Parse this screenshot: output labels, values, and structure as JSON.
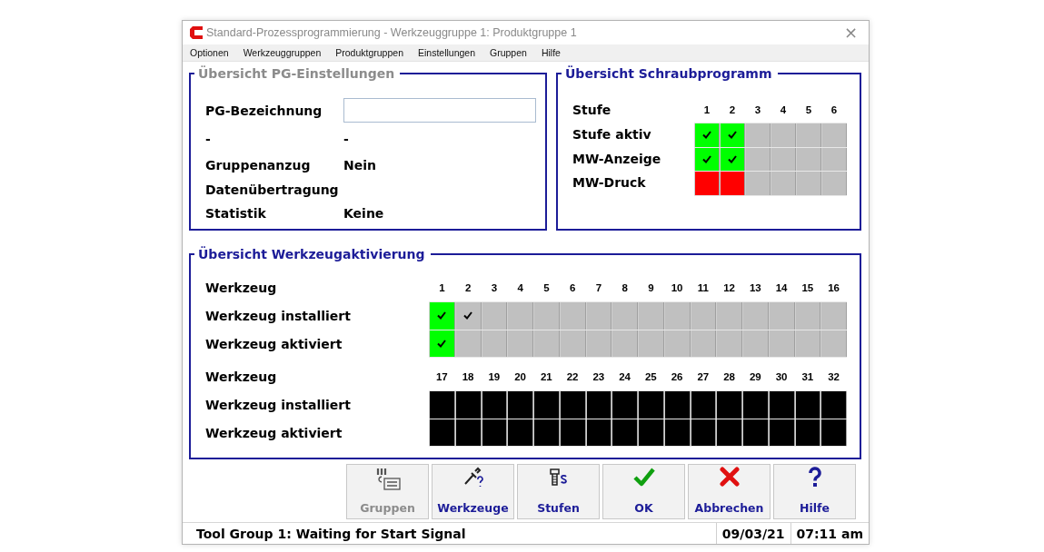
{
  "window": {
    "title": "Standard-Prozessprogrammierung - Werkzeuggruppe 1: Produktgruppe 1",
    "close": "×"
  },
  "menu": [
    {
      "label": "Optionen"
    },
    {
      "label": "Werkzeuggruppen"
    },
    {
      "label": "Produktgruppen"
    },
    {
      "label": "Einstellungen"
    },
    {
      "label": "Gruppen"
    },
    {
      "label": "Hilfe"
    }
  ],
  "pg_settings": {
    "title": "Übersicht PG-Einstellungen",
    "disabled": true,
    "rows": [
      {
        "kind": "field",
        "label": "PG-Bezeichnung"
      },
      {
        "kind": "text",
        "label": "-",
        "value": "-"
      },
      {
        "kind": "text",
        "label": "Gruppenanzug",
        "value": "Nein"
      },
      {
        "kind": "text",
        "label": "Datenübertragung"
      },
      {
        "kind": "text",
        "label": "Statistik",
        "value": "Keine"
      }
    ]
  },
  "screw_program": {
    "title": "Übersicht Schraubprogramm",
    "disabled": false,
    "header_label": "Stufe",
    "numbers": [
      "1",
      "2",
      "3",
      "4",
      "5",
      "6"
    ],
    "rows": [
      {
        "label": "Stufe aktiv",
        "cells": [
          {
            "color": "#00ff00",
            "checked": true
          },
          {
            "color": "#00ff00",
            "checked": true
          },
          {
            "color": "#c0c0c0",
            "checked": false
          },
          {
            "color": "#c0c0c0",
            "checked": false
          },
          {
            "color": "#c0c0c0",
            "checked": false
          },
          {
            "color": "#c0c0c0",
            "checked": false
          }
        ]
      },
      {
        "label": "MW-Anzeige",
        "cells": [
          {
            "color": "#00ff00",
            "checked": true
          },
          {
            "color": "#00ff00",
            "checked": true
          },
          {
            "color": "#c0c0c0",
            "checked": false
          },
          {
            "color": "#c0c0c0",
            "checked": false
          },
          {
            "color": "#c0c0c0",
            "checked": false
          },
          {
            "color": "#c0c0c0",
            "checked": false
          }
        ]
      },
      {
        "label": "MW-Druck",
        "cells": [
          {
            "color": "#ff0000",
            "checked": false
          },
          {
            "color": "#ff0000",
            "checked": false
          },
          {
            "color": "#c0c0c0",
            "checked": false
          },
          {
            "color": "#c0c0c0",
            "checked": false
          },
          {
            "color": "#c0c0c0",
            "checked": false
          },
          {
            "color": "#c0c0c0",
            "checked": false
          }
        ]
      }
    ]
  },
  "tool_activation": {
    "title": "Übersicht Werkzeugaktivierung",
    "disabled": false,
    "blocks": [
      {
        "header_label": "Werkzeug",
        "numbers": [
          "1",
          "2",
          "3",
          "4",
          "5",
          "6",
          "7",
          "8",
          "9",
          "10",
          "11",
          "12",
          "13",
          "14",
          "15",
          "16"
        ],
        "rows": [
          {
            "label": "Werkzeug installiert",
            "cells": [
              {
                "color": "#00ff00",
                "checked": true
              },
              {
                "color": "#c0c0c0",
                "checked": true
              },
              {
                "color": "#c0c0c0",
                "checked": false
              },
              {
                "color": "#c0c0c0",
                "checked": false
              },
              {
                "color": "#c0c0c0",
                "checked": false
              },
              {
                "color": "#c0c0c0",
                "checked": false
              },
              {
                "color": "#c0c0c0",
                "checked": false
              },
              {
                "color": "#c0c0c0",
                "checked": false
              },
              {
                "color": "#c0c0c0",
                "checked": false
              },
              {
                "color": "#c0c0c0",
                "checked": false
              },
              {
                "color": "#c0c0c0",
                "checked": false
              },
              {
                "color": "#c0c0c0",
                "checked": false
              },
              {
                "color": "#c0c0c0",
                "checked": false
              },
              {
                "color": "#c0c0c0",
                "checked": false
              },
              {
                "color": "#c0c0c0",
                "checked": false
              },
              {
                "color": "#c0c0c0",
                "checked": false
              }
            ]
          },
          {
            "label": "Werkzeug aktiviert",
            "cells": [
              {
                "color": "#00ff00",
                "checked": true
              },
              {
                "color": "#c0c0c0",
                "checked": false
              },
              {
                "color": "#c0c0c0",
                "checked": false
              },
              {
                "color": "#c0c0c0",
                "checked": false
              },
              {
                "color": "#c0c0c0",
                "checked": false
              },
              {
                "color": "#c0c0c0",
                "checked": false
              },
              {
                "color": "#c0c0c0",
                "checked": false
              },
              {
                "color": "#c0c0c0",
                "checked": false
              },
              {
                "color": "#c0c0c0",
                "checked": false
              },
              {
                "color": "#c0c0c0",
                "checked": false
              },
              {
                "color": "#c0c0c0",
                "checked": false
              },
              {
                "color": "#c0c0c0",
                "checked": false
              },
              {
                "color": "#c0c0c0",
                "checked": false
              },
              {
                "color": "#c0c0c0",
                "checked": false
              },
              {
                "color": "#c0c0c0",
                "checked": false
              },
              {
                "color": "#c0c0c0",
                "checked": false
              }
            ]
          }
        ]
      },
      {
        "header_label": "Werkzeug",
        "numbers": [
          "17",
          "18",
          "19",
          "20",
          "21",
          "22",
          "23",
          "24",
          "25",
          "26",
          "27",
          "28",
          "29",
          "30",
          "31",
          "32"
        ],
        "rows": [
          {
            "label": "Werkzeug installiert",
            "cells": [
              {
                "color": "#000000"
              },
              {
                "color": "#000000"
              },
              {
                "color": "#000000"
              },
              {
                "color": "#000000"
              },
              {
                "color": "#000000"
              },
              {
                "color": "#000000"
              },
              {
                "color": "#000000"
              },
              {
                "color": "#000000"
              },
              {
                "color": "#000000"
              },
              {
                "color": "#000000"
              },
              {
                "color": "#000000"
              },
              {
                "color": "#000000"
              },
              {
                "color": "#000000"
              },
              {
                "color": "#000000"
              },
              {
                "color": "#000000"
              },
              {
                "color": "#000000"
              }
            ]
          },
          {
            "label": "Werkzeug aktiviert",
            "cells": [
              {
                "color": "#000000"
              },
              {
                "color": "#000000"
              },
              {
                "color": "#000000"
              },
              {
                "color": "#000000"
              },
              {
                "color": "#000000"
              },
              {
                "color": "#000000"
              },
              {
                "color": "#000000"
              },
              {
                "color": "#000000"
              },
              {
                "color": "#000000"
              },
              {
                "color": "#000000"
              },
              {
                "color": "#000000"
              },
              {
                "color": "#000000"
              },
              {
                "color": "#000000"
              },
              {
                "color": "#000000"
              },
              {
                "color": "#000000"
              },
              {
                "color": "#000000"
              }
            ]
          }
        ]
      }
    ]
  },
  "buttons": [
    {
      "kind": "groups",
      "label": "Gruppen",
      "disabled": true
    },
    {
      "kind": "tools",
      "label": "Werkzeuge",
      "disabled": false
    },
    {
      "kind": "steps",
      "label": "Stufen",
      "disabled": false
    },
    {
      "kind": "ok",
      "label": "OK",
      "disabled": false
    },
    {
      "kind": "cancel",
      "label": "Abbrechen",
      "disabled": false
    },
    {
      "kind": "help",
      "label": "Hilfe",
      "disabled": false
    }
  ],
  "status_bar": {
    "message": "Tool Group 1: Waiting for Start Signal",
    "date": "09/03/21",
    "time": "07:11 am"
  }
}
